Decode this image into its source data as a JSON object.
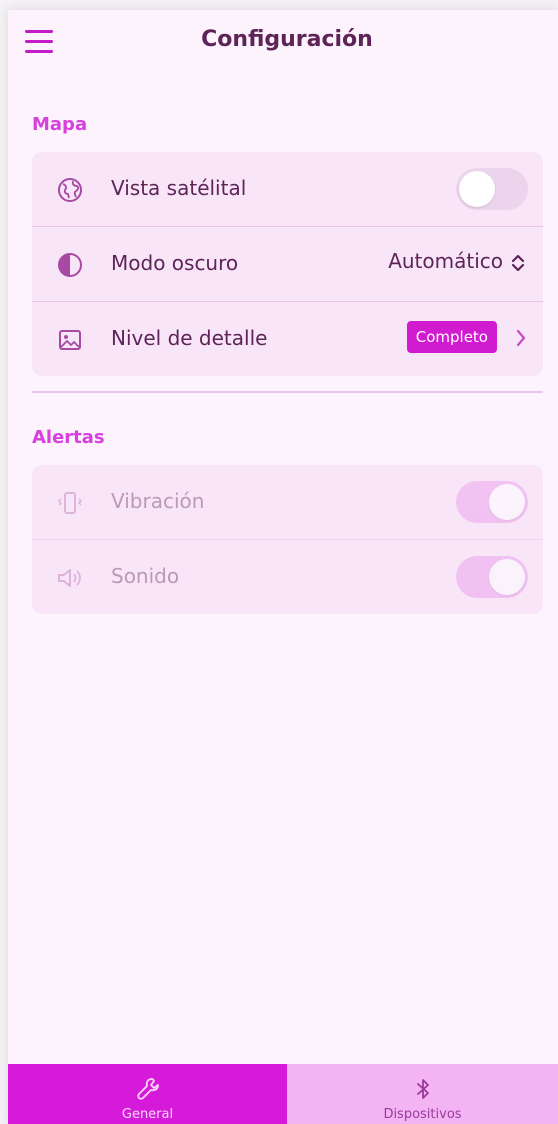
{
  "header": {
    "title": "Configuración",
    "menu_icon": "hamburger-menu-icon"
  },
  "sections": [
    {
      "title": "Mapa",
      "rows": [
        {
          "label": "Vista satélital",
          "icon": "globe-icon",
          "control": "toggle",
          "checked": false
        },
        {
          "label": "Modo oscuro",
          "icon": "contrast-icon",
          "control": "select",
          "value": "Automático"
        },
        {
          "label": "Nivel de detalle",
          "icon": "image-icon",
          "control": "badge-link",
          "value": "Completo"
        }
      ]
    },
    {
      "title": "Alertas",
      "disabled": true,
      "rows": [
        {
          "label": "Vibración",
          "icon": "vibration-icon",
          "control": "toggle",
          "checked": true
        },
        {
          "label": "Sonido",
          "icon": "speaker-icon",
          "control": "toggle",
          "checked": true
        }
      ]
    }
  ],
  "tabbar": {
    "tabs": [
      {
        "label": "General",
        "icon": "wrench-icon",
        "active": true
      },
      {
        "label": "Dispositivos",
        "icon": "bluetooth-icon",
        "active": false
      }
    ]
  },
  "colors": {
    "accent": "#d51bd9",
    "text": "#5e2358",
    "section_title": "#d640dd",
    "card_background": "#f8e6f8",
    "page_background": "#fcf3fc"
  }
}
